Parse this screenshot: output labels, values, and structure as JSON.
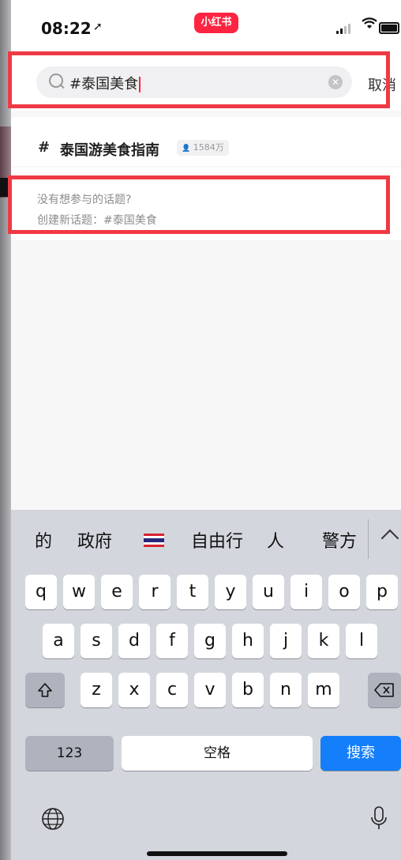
{
  "status_bar": {
    "time": "08:22",
    "location_icon": "location-arrow-icon",
    "app_badge": "小红书"
  },
  "search": {
    "query": "#泰国美食",
    "cancel_label": "取消"
  },
  "topic_suggestion": {
    "hash": "#",
    "name": "泰国游美食指南",
    "count": "1584万"
  },
  "create_topic": {
    "line1": "没有想参与的话题?",
    "line2": "创建新话题：#泰国美食"
  },
  "keyboard": {
    "suggestions": [
      "的",
      "政府",
      "自由行",
      "人",
      "警方"
    ],
    "row1": [
      "q",
      "w",
      "e",
      "r",
      "t",
      "y",
      "u",
      "i",
      "o",
      "p"
    ],
    "row2": [
      "a",
      "s",
      "d",
      "f",
      "g",
      "h",
      "j",
      "k",
      "l"
    ],
    "row3": [
      "z",
      "x",
      "c",
      "v",
      "b",
      "n",
      "m"
    ],
    "numbers_label": "123",
    "space_label": "空格",
    "search_label": "搜索"
  },
  "colors": {
    "brand_red": "#ff2441",
    "highlight_red": "#ee3a44",
    "keyboard_blue": "#147efb"
  }
}
